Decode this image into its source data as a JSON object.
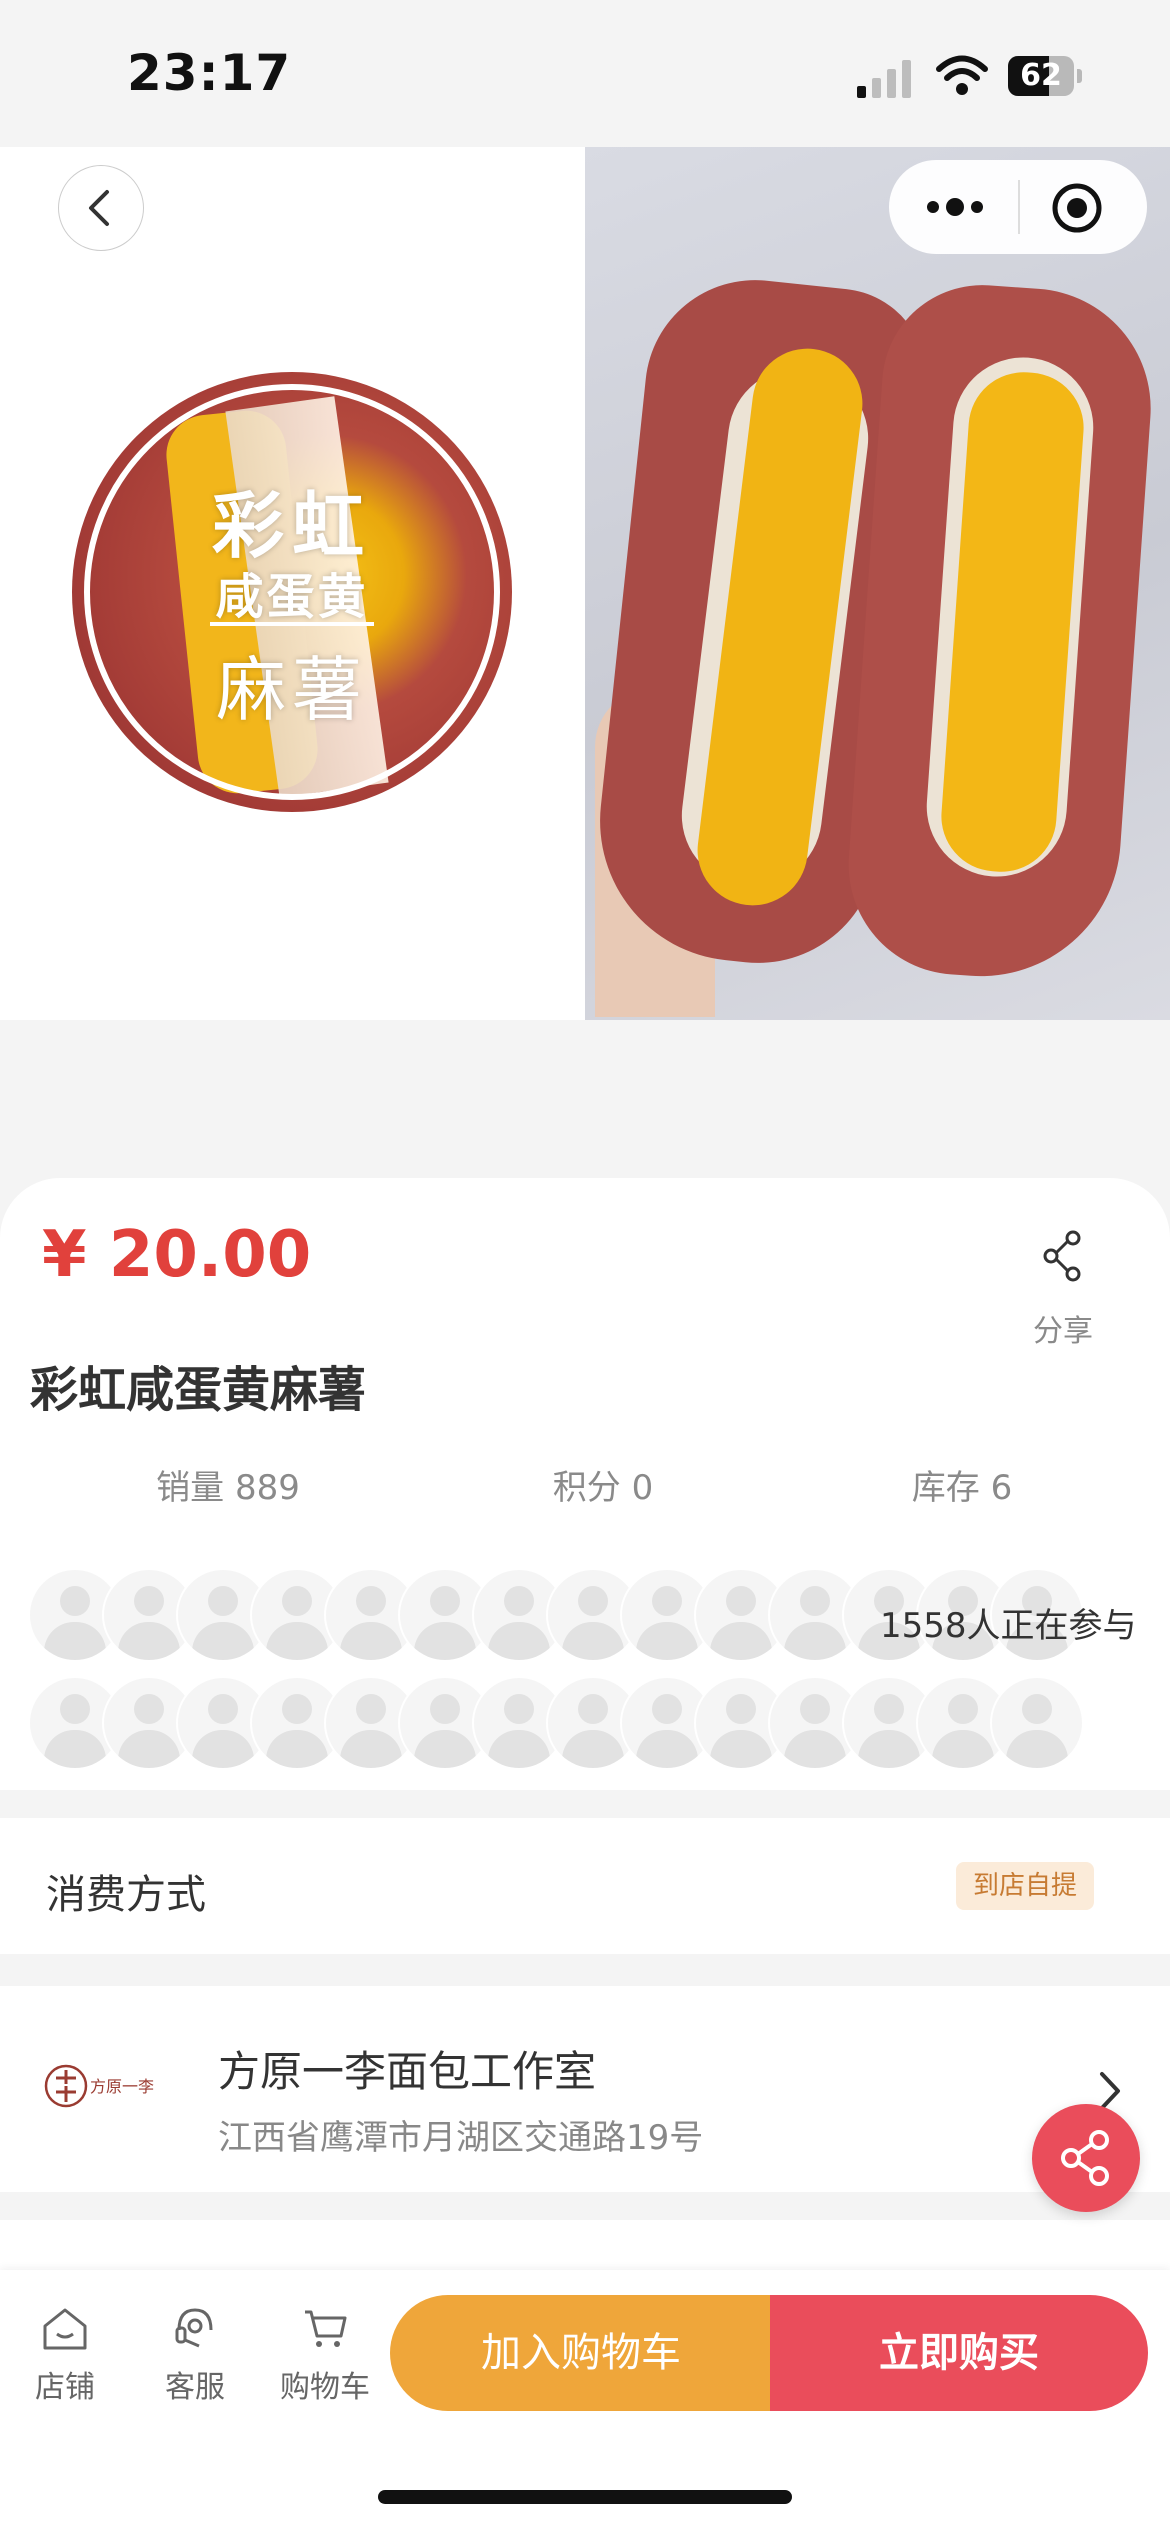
{
  "status_bar": {
    "time": "23:17",
    "battery": "62",
    "battery_level_percent": 62
  },
  "gallery": {
    "badge": {
      "line1": "彩虹",
      "line2": "咸蛋黄",
      "line3": "麻薯"
    },
    "photo_icon": "bread-photo"
  },
  "nav": {
    "back_icon": "chevron-left-icon",
    "more_icon": "more-dots-icon",
    "close_icon": "target-circle-icon"
  },
  "product": {
    "price": "¥ 20.00",
    "title": "彩虹咸蛋黄麻薯",
    "share_label": "分享",
    "stats": [
      {
        "label": "销量 889"
      },
      {
        "label": "积分 0"
      },
      {
        "label": "库存 6"
      }
    ],
    "participants": "1558人正在参与",
    "avatar_rows": 2,
    "avatars_per_row": 14
  },
  "consume": {
    "label": "消费方式",
    "tag": "到店自提"
  },
  "shop": {
    "logo_text": "方原一李",
    "name": "方原一李面包工作室",
    "address": "江西省鹰潭市月湖区交通路19号"
  },
  "bottom_bar": {
    "tabs": [
      {
        "label": "店铺",
        "icon": "store-icon"
      },
      {
        "label": "客服",
        "icon": "headset-icon"
      },
      {
        "label": "购物车",
        "icon": "cart-icon"
      }
    ],
    "add_cart": "加入购物车",
    "buy_now": "立即购买"
  },
  "colors": {
    "price": "#e1413c",
    "cart_button": "#efa63a",
    "buy_button": "#ea4d5b",
    "tag_text": "#c77b33"
  }
}
